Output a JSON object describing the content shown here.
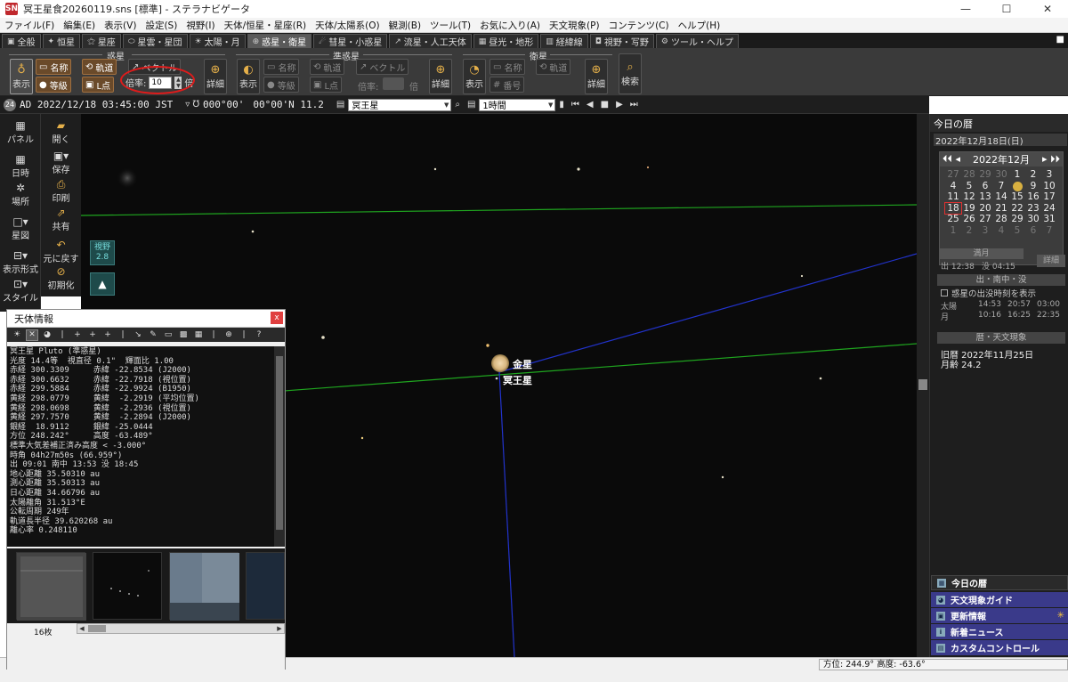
{
  "window": {
    "title": "冥王星食20260119.sns [標準] - ステラナビゲータ",
    "app_icon_label": "SN"
  },
  "window_controls": {
    "minimize": "—",
    "maximize": "☐",
    "close": "✕"
  },
  "menu": [
    "ファイル(F)",
    "編集(E)",
    "表示(V)",
    "設定(S)",
    "視野(I)",
    "天体/恒星・星座(R)",
    "天体/太陽系(O)",
    "観測(B)",
    "ツール(T)",
    "お気に入り(A)",
    "天文現象(P)",
    "コンテンツ(C)",
    "ヘルプ(H)"
  ],
  "tabs": [
    {
      "label": "全般",
      "icon": "▣"
    },
    {
      "label": "恒星",
      "icon": "✦"
    },
    {
      "label": "星座",
      "icon": "⚝"
    },
    {
      "label": "星雲・星団",
      "icon": "⬭"
    },
    {
      "label": "太陽・月",
      "icon": "☀"
    },
    {
      "label": "惑星・衛星",
      "icon": "⊕"
    },
    {
      "label": "彗星・小惑星",
      "icon": "☄"
    },
    {
      "label": "流星・人工天体",
      "icon": "↗"
    },
    {
      "label": "昼光・地形",
      "icon": "▦"
    },
    {
      "label": "経緯線",
      "icon": "▥"
    },
    {
      "label": "視野・写野",
      "icon": "◘"
    },
    {
      "label": "ツール・ヘルプ",
      "icon": "⚙"
    }
  ],
  "tab_right_mark": "■",
  "ribbon": {
    "planet_group": "惑星",
    "dwarf_group": "準惑星",
    "satellite_group": "衛星",
    "show": "表示",
    "name": "名称",
    "orbit": "軌道",
    "vector": "ベクトル",
    "grade": "等級",
    "lpoint": "L点",
    "mag_label": "倍率:",
    "mag_value": "10",
    "mag_unit": "倍",
    "detail": "詳細",
    "number": "番号",
    "search": "検索"
  },
  "infobar": {
    "badge": "24",
    "datetime": "AD  2022/12/18  03:45:00  JST",
    "hour_icon": "▿ ℧",
    "coord1": "000°00'",
    "coord2": "00°00'N  11.2",
    "object_select": "冥王星",
    "interval_select": "1時間",
    "playback": [
      "⏮",
      "◀",
      "■",
      "▶",
      "⏭"
    ]
  },
  "left_panel": {
    "panel": "パネル",
    "datetime": "日時",
    "place": "場所",
    "chart": "星図",
    "display_format": "表示形式",
    "style": "スタイル"
  },
  "left_panel2": {
    "open": "開く",
    "save": "保存",
    "print": "印刷",
    "share": "共有",
    "undo": "元に戻す",
    "reset": "初期化"
  },
  "fov": {
    "label": "視野",
    "value": "2.8"
  },
  "sky_labels": {
    "venus": "金星",
    "pluto": "冥王星"
  },
  "dialog": {
    "title": "天体情報",
    "close": "x",
    "lines": [
      "冥王星 Pluto (準惑星)",
      "光度 14.4等  視直径 0.1\"  輝面比 1.00",
      "赤経 300.3309     赤緯 -22.8534 (J2000)",
      "赤経 300.6632     赤緯 -22.7918 (視位置)",
      "赤経 299.5884     赤緯 -22.9924 (B1950)",
      "黄経 298.0779     黄緯  -2.2919 (平均位置)",
      "黄経 298.0698     黄緯  -2.2936 (視位置)",
      "黄経 297.7570     黄緯  -2.2894 (J2000)",
      "銀経  18.9112     銀緯 -25.0444",
      "方位 248.242°     高度 -63.489°",
      "標準大気差補正済み高度 < -3.000°",
      "時角 04h27m50s (66.959°)",
      "出 09:01 南中 13:53 没 18:45",
      "地心距離 35.50310 au",
      "測心距離 35.50313 au",
      "日心距離 34.66796 au",
      "太陽離角 31.513°E",
      "公転周期 249年",
      "軌道長半径 39.620268 au",
      "離心率 0.248110"
    ],
    "image_count": "16枚"
  },
  "today_panel": {
    "header": "今日の暦",
    "date": "2022年12月18日(日)",
    "calendar_title": "2022年12月",
    "weeks": [
      [
        "27",
        "28",
        "29",
        "30",
        "1",
        "2",
        "3"
      ],
      [
        "4",
        "5",
        "6",
        "7",
        "●",
        "9",
        "10"
      ],
      [
        "11",
        "12",
        "13",
        "14",
        "15",
        "16",
        "17"
      ],
      [
        "18",
        "19",
        "20",
        "21",
        "22",
        "23",
        "24"
      ],
      [
        "25",
        "26",
        "27",
        "28",
        "29",
        "30",
        "31"
      ],
      [
        "1",
        "2",
        "3",
        "4",
        "5",
        "6",
        "7"
      ]
    ],
    "moon_phase": "満月",
    "sun_rise": "出 12:38",
    "sun_set": "没 04:15",
    "detail_btn": "詳細",
    "riseset_title": "出・南中・没",
    "planet_times": "惑星の出没時刻を表示",
    "rows": [
      {
        "name": "太陽",
        "rise": "14:53",
        "transit": "20:57",
        "set": "03:00"
      },
      {
        "name": "月",
        "rise": "10:16",
        "transit": "16:25",
        "set": "22:35"
      }
    ],
    "calendar_events": "暦・天文現象",
    "old_calendar": "旧暦 2022年11月25日",
    "moon_age": "月齢 24.2"
  },
  "right_buttons": [
    "今日の暦",
    "天文現象ガイド",
    "更新情報",
    "新着ニュース",
    "カスタムコントロール"
  ],
  "status": "方位: 244.9°  高度: -63.6°"
}
